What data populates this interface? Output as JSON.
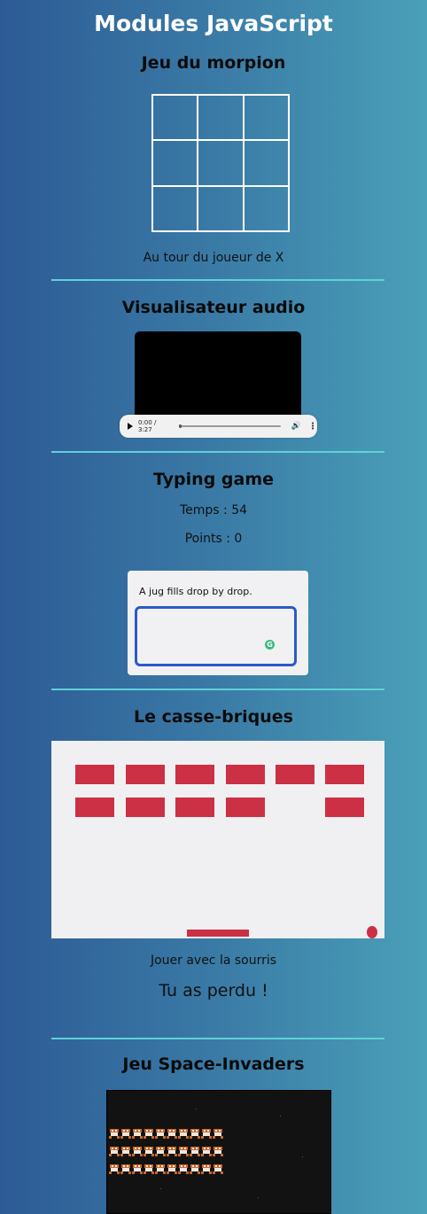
{
  "page": {
    "title": "Modules JavaScript"
  },
  "morpion": {
    "title": "Jeu du morpion",
    "cells": [
      "",
      "",
      "",
      "",
      "",
      "",
      "",
      "",
      ""
    ],
    "status": "Au tour du joueur de X"
  },
  "audio": {
    "title": "Visualisateur audio",
    "time": "0:00 / 3:27",
    "progress": 0,
    "colors": {
      "screen": "#000000",
      "player": "#f1f1f1"
    }
  },
  "typing": {
    "title": "Typing game",
    "time": "Temps : 54",
    "points": "Points : 0",
    "sentence": "A jug fills drop by drop.",
    "input_value": "",
    "icon": "grammarly-icon"
  },
  "breakout": {
    "title": "Le casse-briques",
    "instruction": "Jouer avec la sourris",
    "result": "Tu as perdu !",
    "brick_color": "#cc3044",
    "bricks": [
      [
        true,
        true,
        true,
        true,
        true,
        true
      ],
      [
        true,
        true,
        true,
        true,
        false,
        true
      ]
    ]
  },
  "invaders": {
    "title": "Jeu Space-Invaders",
    "rows": 3,
    "per_row": 10
  },
  "colors": {
    "divider": "#5fd1d8",
    "accent": "#2c5ac6"
  }
}
